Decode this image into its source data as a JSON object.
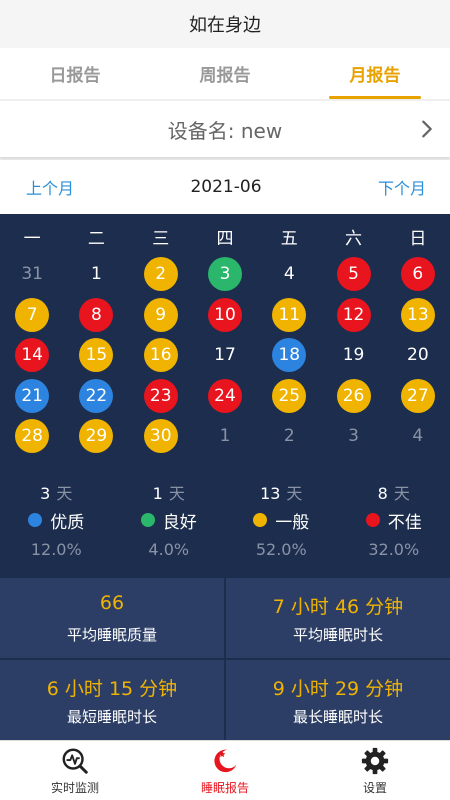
{
  "app_title": "如在身边",
  "tabs": [
    {
      "label": "日报告",
      "active": false
    },
    {
      "label": "周报告",
      "active": false
    },
    {
      "label": "月报告",
      "active": true
    }
  ],
  "device_label": "设备名: new",
  "month_nav": {
    "prev": "上个月",
    "current": "2021-06",
    "next": "下个月"
  },
  "weekdays": [
    "一",
    "二",
    "三",
    "四",
    "五",
    "六",
    "日"
  ],
  "days": [
    {
      "n": "31",
      "s": "other"
    },
    {
      "n": "1",
      "s": "none"
    },
    {
      "n": "2",
      "s": "yellow"
    },
    {
      "n": "3",
      "s": "green"
    },
    {
      "n": "4",
      "s": "none"
    },
    {
      "n": "5",
      "s": "red"
    },
    {
      "n": "6",
      "s": "red"
    },
    {
      "n": "7",
      "s": "yellow"
    },
    {
      "n": "8",
      "s": "red"
    },
    {
      "n": "9",
      "s": "yellow"
    },
    {
      "n": "10",
      "s": "red"
    },
    {
      "n": "11",
      "s": "yellow"
    },
    {
      "n": "12",
      "s": "red"
    },
    {
      "n": "13",
      "s": "yellow"
    },
    {
      "n": "14",
      "s": "red"
    },
    {
      "n": "15",
      "s": "yellow"
    },
    {
      "n": "16",
      "s": "yellow"
    },
    {
      "n": "17",
      "s": "none"
    },
    {
      "n": "18",
      "s": "blue"
    },
    {
      "n": "19",
      "s": "none"
    },
    {
      "n": "20",
      "s": "none"
    },
    {
      "n": "21",
      "s": "blue"
    },
    {
      "n": "22",
      "s": "blue"
    },
    {
      "n": "23",
      "s": "red"
    },
    {
      "n": "24",
      "s": "red"
    },
    {
      "n": "25",
      "s": "yellow"
    },
    {
      "n": "26",
      "s": "yellow"
    },
    {
      "n": "27",
      "s": "yellow"
    },
    {
      "n": "28",
      "s": "yellow"
    },
    {
      "n": "29",
      "s": "yellow"
    },
    {
      "n": "30",
      "s": "yellow"
    },
    {
      "n": "1",
      "s": "other"
    },
    {
      "n": "2",
      "s": "other"
    },
    {
      "n": "3",
      "s": "other"
    },
    {
      "n": "4",
      "s": "other"
    }
  ],
  "stats": [
    {
      "count": "3",
      "unit": "天",
      "label": "优质",
      "pct": "12.0%",
      "color": "#2c84e0"
    },
    {
      "count": "1",
      "unit": "天",
      "label": "良好",
      "pct": "4.0%",
      "color": "#2ab66b"
    },
    {
      "count": "13",
      "unit": "天",
      "label": "一般",
      "pct": "52.0%",
      "color": "#f0b400"
    },
    {
      "count": "8",
      "unit": "天",
      "label": "不佳",
      "pct": "32.0%",
      "color": "#e8141e"
    }
  ],
  "summary": [
    {
      "value": "66",
      "label": "平均睡眠质量"
    },
    {
      "value": "7 小时 46 分钟",
      "label": "平均睡眠时长"
    },
    {
      "value": "6 小时 15 分钟",
      "label": "最短睡眠时长"
    },
    {
      "value": "9 小时 29 分钟",
      "label": "最长睡眠时长"
    }
  ],
  "bottom_nav": [
    {
      "label": "实时监测",
      "icon": "monitor-icon",
      "active": false
    },
    {
      "label": "睡眠报告",
      "icon": "sleep-moon-icon",
      "active": true
    },
    {
      "label": "设置",
      "icon": "gear-icon",
      "active": false
    }
  ],
  "colors": {
    "accent": "#e8a200",
    "calendar_bg": "#1d2d4d",
    "summary_cell": "#2d3e66",
    "link": "#2a8fd8"
  }
}
